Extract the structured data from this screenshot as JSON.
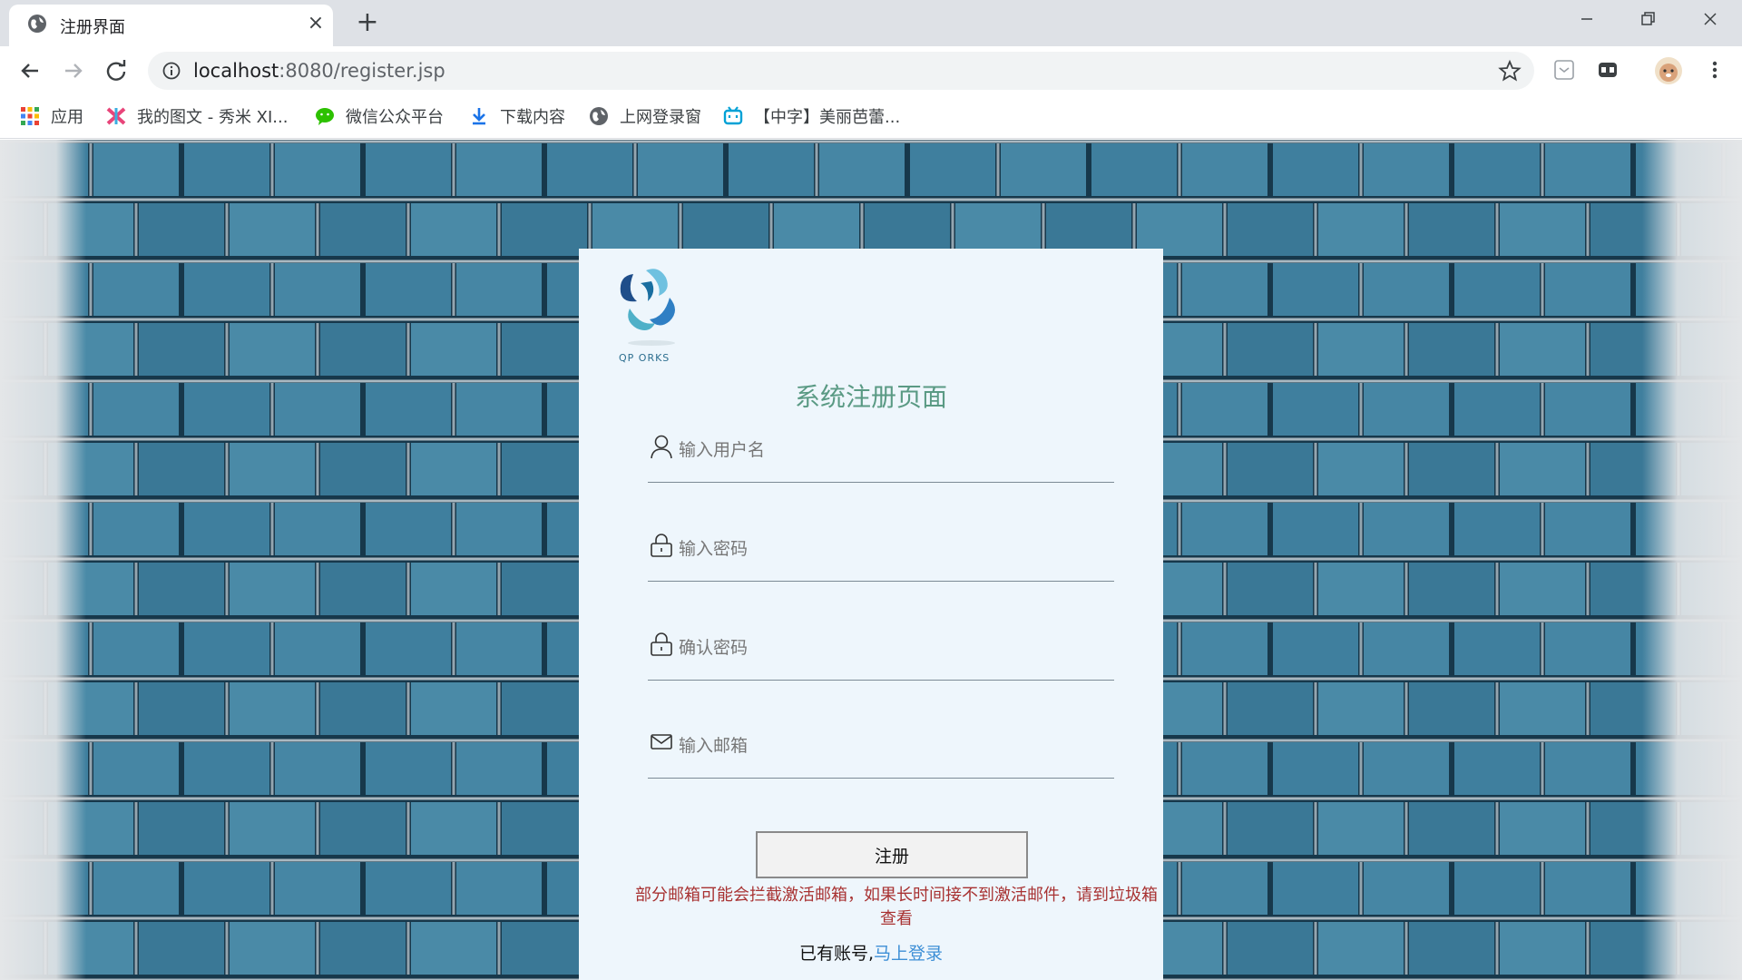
{
  "browser": {
    "tab_title": "注册界面",
    "url_host": "localhost",
    "url_path": ":8080/register.jsp"
  },
  "bookmarks": [
    {
      "label": "应用",
      "icon": "apps-grid-icon"
    },
    {
      "label": "我的图文 - 秀米 XI...",
      "icon": "xiumi-icon"
    },
    {
      "label": "微信公众平台",
      "icon": "wechat-icon"
    },
    {
      "label": "下载内容",
      "icon": "download-icon"
    },
    {
      "label": "上网登录窗",
      "icon": "globe-icon"
    },
    {
      "label": "【中字】美丽芭蕾...",
      "icon": "bilibili-icon"
    }
  ],
  "page": {
    "logo_text": "QP   ORKS",
    "title": "系统注册页面",
    "fields": {
      "username_placeholder": "输入用户名",
      "password_placeholder": "输入密码",
      "confirm_placeholder": "确认密码",
      "email_placeholder": "输入邮箱"
    },
    "register_button": "注册",
    "warning": "部分邮箱可能会拦截激活邮箱，如果长时间接不到激活邮件，请到垃圾箱查看",
    "have_account": "已有账号,",
    "login_link": "马上登录"
  },
  "colors": {
    "title": "#5a9a84",
    "warning": "#a83232",
    "link": "#3d8fd6",
    "wall": "#3f7f9e"
  }
}
